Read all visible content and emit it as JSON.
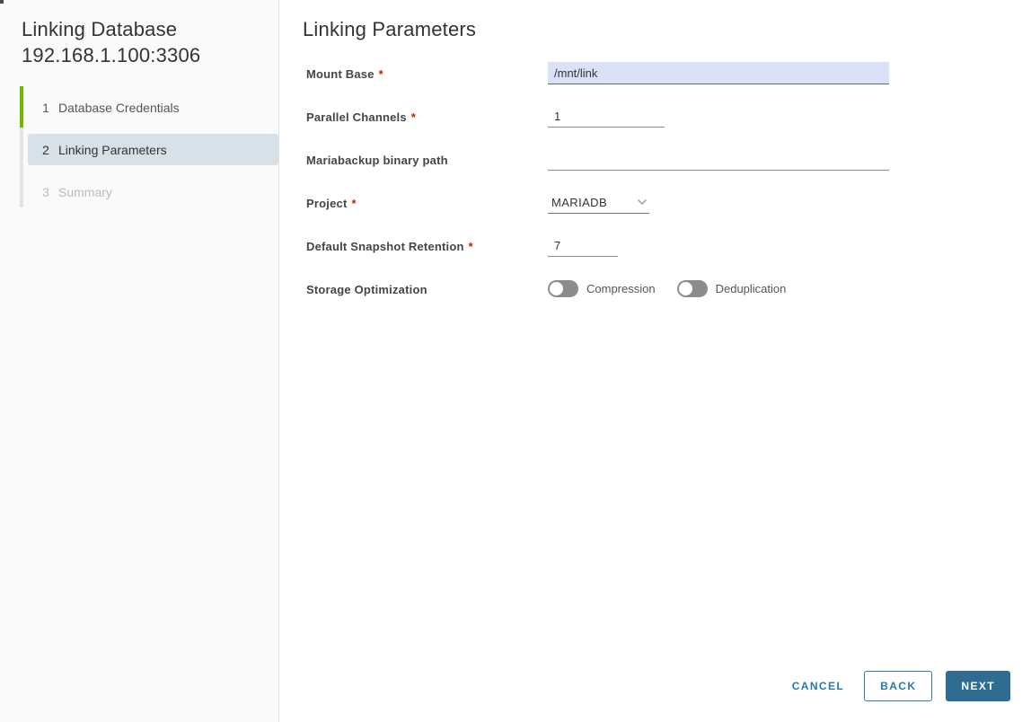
{
  "window": {
    "title_line1": "Linking Database",
    "title_line2": "192.168.1.100:3306"
  },
  "wizard": {
    "steps": [
      {
        "number": "1",
        "label": "Database Credentials",
        "state": "complete"
      },
      {
        "number": "2",
        "label": "Linking Parameters",
        "state": "current"
      },
      {
        "number": "3",
        "label": "Summary",
        "state": "disabled"
      }
    ]
  },
  "content": {
    "heading": "Linking Parameters",
    "fields": {
      "mount_base": {
        "label": "Mount Base",
        "required": true,
        "value": "/mnt/link"
      },
      "parallel_channels": {
        "label": "Parallel Channels",
        "required": true,
        "value": "1"
      },
      "mariabackup_path": {
        "label": "Mariabackup binary path",
        "required": false,
        "value": ""
      },
      "project": {
        "label": "Project",
        "required": true,
        "value": "MARIADB"
      },
      "snapshot_retention": {
        "label": "Default Snapshot Retention",
        "required": true,
        "value": "7"
      },
      "storage_optimization": {
        "label": "Storage Optimization",
        "toggles": {
          "compression": {
            "label": "Compression",
            "on": false
          },
          "deduplication": {
            "label": "Deduplication",
            "on": false
          }
        }
      }
    }
  },
  "footer": {
    "cancel_label": "CANCEL",
    "back_label": "BACK",
    "next_label": "NEXT"
  },
  "ui": {
    "required_marker": "*",
    "colors": {
      "step_progress_green": "#71b600",
      "active_step_highlight": "#d8e0e8",
      "selected_input_bg": "#dbe2f8",
      "link_blue": "#2878ab",
      "primary_button_bg": "#2e6c92",
      "required_red": "#c92100",
      "toggle_off_gray": "#8c8c8c",
      "sidebar_bg": "#fafafa"
    }
  }
}
